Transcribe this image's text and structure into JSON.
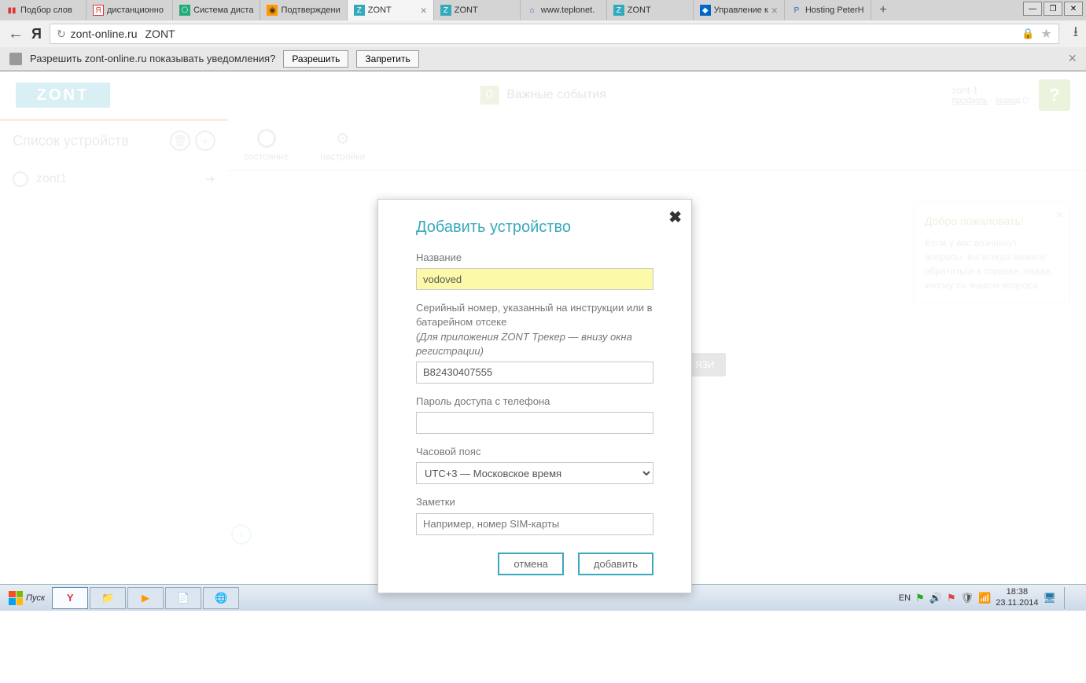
{
  "browser": {
    "tabs": [
      {
        "label": "Подбор слов"
      },
      {
        "label": "дистанционно"
      },
      {
        "label": "Система диста"
      },
      {
        "label": "Подтверждени"
      },
      {
        "label": "ZONT",
        "active": true
      },
      {
        "label": "ZONT"
      },
      {
        "label": "www.teplonet."
      },
      {
        "label": "ZONT"
      },
      {
        "label": "Управление к"
      },
      {
        "label": "Hosting PeterH"
      }
    ],
    "address": {
      "host": "zont-online.ru",
      "title": "ZONT"
    },
    "notification": {
      "text": "Разрешить zont-online.ru показывать уведомления?",
      "allow": "Разрешить",
      "deny": "Запретить"
    }
  },
  "page": {
    "logo": "ZONT",
    "events": {
      "count": "0",
      "label": "Важные события"
    },
    "user": {
      "name": "zont-1",
      "profile": "профиль",
      "logout": "выход"
    },
    "sidebar": {
      "title": "Список устройств",
      "device": "zont1"
    },
    "tabs": {
      "t1": "состояние",
      "t2": "настройки"
    },
    "hidden_btn": "ЯЗИ",
    "welcome": {
      "title": "Добро пожаловать!",
      "body": "Если у вас возникнут вопросы, вы всегда можете обратиться к справке, нажав кнопку со знаком вопроса"
    }
  },
  "modal": {
    "title": "Добавить устройство",
    "name_label": "Название",
    "name_value": "vodoved",
    "serial_label_1": "Серийный номер, указанный на инструкции или в батарейном отсеке",
    "serial_label_2": "(Для приложения ZONT Трекер — внизу окна регистрации)",
    "serial_value": "B82430407555",
    "password_label": "Пароль доступа с телефона",
    "password_value": "",
    "tz_label": "Часовой пояс",
    "tz_value": "UTC+3 — Московское время",
    "notes_label": "Заметки",
    "notes_placeholder": "Например, номер SIM-карты",
    "cancel": "отмена",
    "submit": "добавить"
  },
  "taskbar": {
    "start": "Пуск",
    "lang": "EN",
    "time": "18:38",
    "date": "23.11.2014"
  }
}
